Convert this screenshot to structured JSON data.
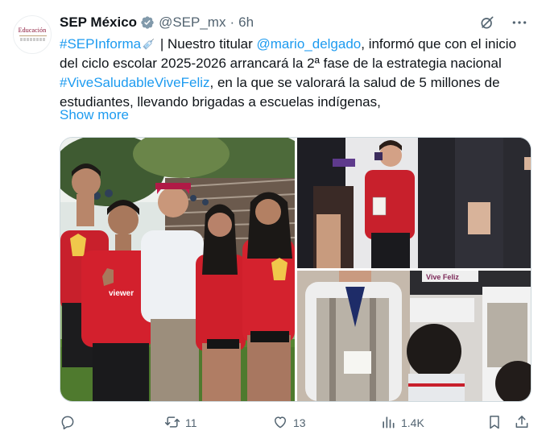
{
  "account": {
    "name": "SEP México",
    "handle": "@SEP_mx",
    "separator": "·",
    "time": "6h",
    "avatar_text": "Educación"
  },
  "post": {
    "line1": {
      "hashtag1": "#SEPInforma",
      "text1": " | Nuestro titular ",
      "mention": "@mario_delgado",
      "text2": ", informó que con el inicio"
    },
    "line2": "del ciclo escolar 2025-2026 arrancará la 2ª fase de la estrategia nacional",
    "line3": {
      "hashtag2": "#ViveSaludableViveFeliz",
      "text": ", en la que se valorará la salud de 5 millones de"
    },
    "line4": "estudiantes, llevando brigadas a escuelas indígenas,",
    "show_more": "Show more"
  },
  "media": {
    "photo1_shirt_text": "viewer",
    "photo3_banner": "Vive Feliz"
  },
  "metrics": {
    "retweets": "11",
    "likes": "13",
    "views": "1.4K"
  },
  "colors": {
    "link": "#1d9bf0",
    "secondary": "#536471",
    "verified": "#829aab"
  },
  "icons": [
    "verified-badge-icon",
    "grok-icon",
    "more-icon",
    "reply-icon",
    "retweet-icon",
    "like-icon",
    "views-icon",
    "bookmark-icon",
    "share-icon",
    "syringe-emoji-icon"
  ]
}
